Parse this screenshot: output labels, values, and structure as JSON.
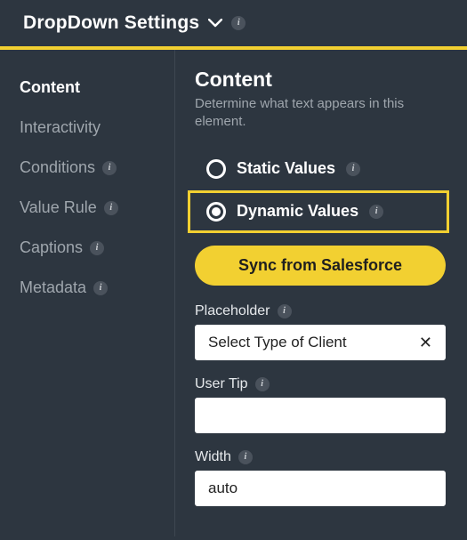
{
  "header": {
    "title": "DropDown Settings"
  },
  "sidebar": {
    "items": [
      {
        "label": "Content",
        "info": false,
        "active": true
      },
      {
        "label": "Interactivity",
        "info": false,
        "active": false
      },
      {
        "label": "Conditions",
        "info": true,
        "active": false
      },
      {
        "label": "Value Rule",
        "info": true,
        "active": false
      },
      {
        "label": "Captions",
        "info": true,
        "active": false
      },
      {
        "label": "Metadata",
        "info": true,
        "active": false
      }
    ]
  },
  "main": {
    "title": "Content",
    "description": "Determine what text appears in this element.",
    "radios": {
      "static_label": "Static Values",
      "dynamic_label": "Dynamic Values",
      "selected": "dynamic"
    },
    "sync_button": "Sync from Salesforce",
    "fields": {
      "placeholder": {
        "label": "Placeholder",
        "value": "Select Type of Client"
      },
      "user_tip": {
        "label": "User Tip",
        "value": ""
      },
      "width": {
        "label": "Width",
        "value": "auto"
      }
    }
  }
}
